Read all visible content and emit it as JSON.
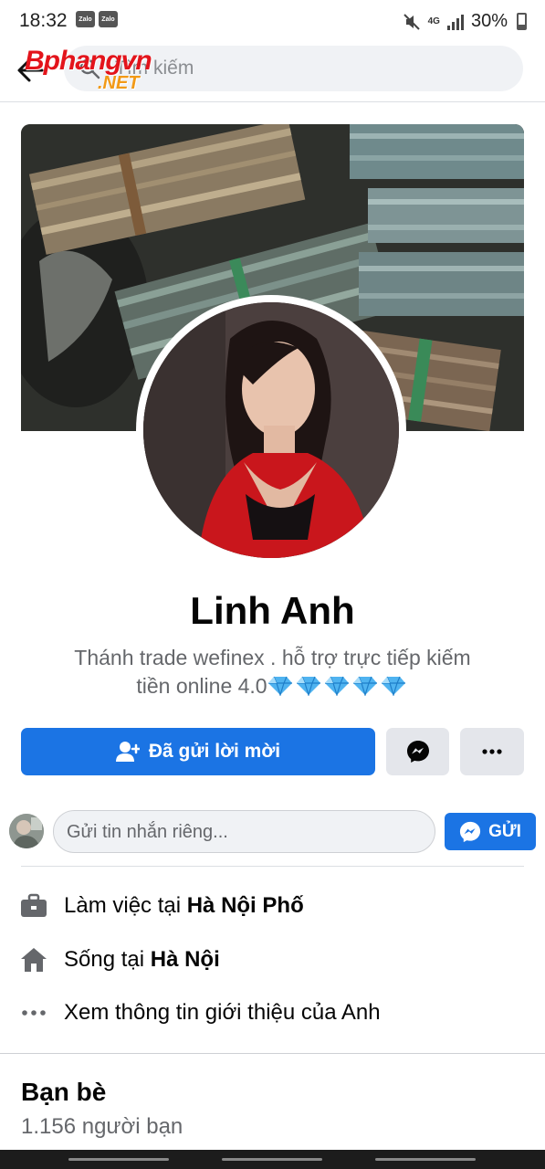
{
  "status_bar": {
    "time": "18:32",
    "notification_badges": [
      "Zalo",
      "Zalo"
    ],
    "network": "4G",
    "battery": "30%"
  },
  "header": {
    "search_placeholder": "Tìm kiếm",
    "watermark_main": "Bphangvn",
    "watermark_sub": ".NET"
  },
  "profile": {
    "name": "Linh Anh",
    "bio_line1": "Thánh trade wefinex . hỗ trợ trực tiếp kiếm",
    "bio_line2": "tiền online 4.0",
    "bio_emoji_count": 5
  },
  "actions": {
    "primary_label": "Đã gửi lời mời",
    "messenger_icon": "messenger-icon",
    "more_icon": "more-icon"
  },
  "message": {
    "placeholder": "Gửi tin nhắn riêng...",
    "send_label": "GỬI"
  },
  "intro": {
    "work_prefix": "Làm việc tại ",
    "work_place": "Hà Nội Phố",
    "live_prefix": "Sống tại ",
    "live_place": "Hà Nội",
    "see_more": "Xem thông tin giới thiệu của Anh"
  },
  "friends": {
    "title": "Bạn bè",
    "count": "1.156 người bạn"
  },
  "colors": {
    "primary": "#1b74e4",
    "secondary_text": "#65676b",
    "grey_button": "#e4e6eb"
  }
}
